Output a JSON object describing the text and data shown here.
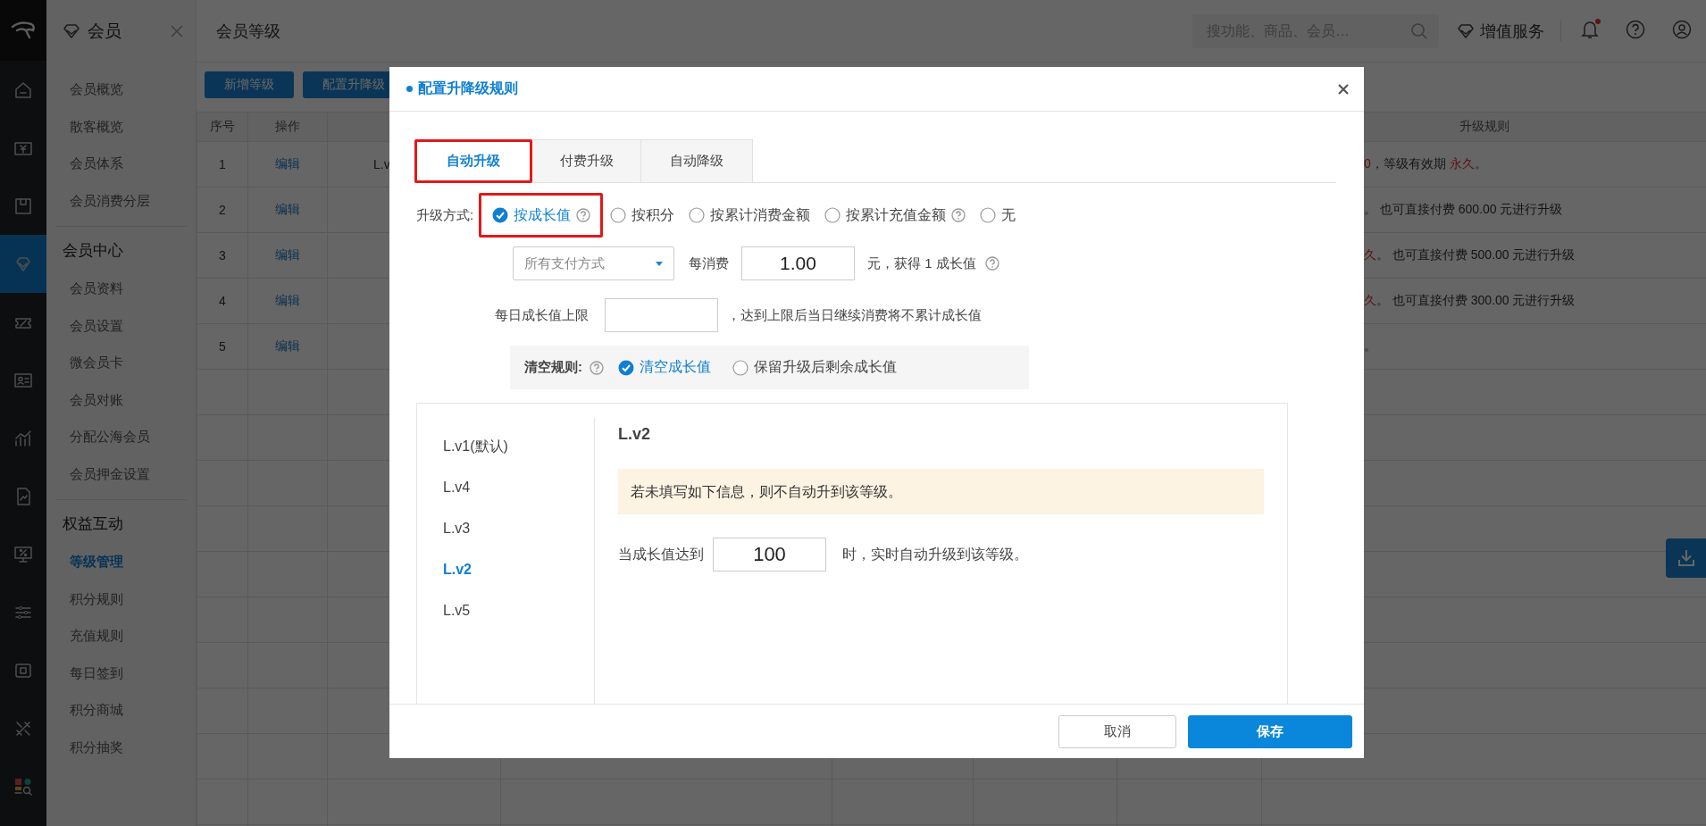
{
  "rail": {
    "items": [
      {
        "selected": false
      },
      {
        "selected": false
      },
      {
        "selected": false
      },
      {
        "selected": true
      },
      {
        "selected": false
      },
      {
        "selected": false
      },
      {
        "selected": false
      },
      {
        "selected": false
      },
      {
        "selected": false
      },
      {
        "selected": false
      },
      {
        "selected": false
      },
      {
        "selected": false
      },
      {
        "selected": false
      }
    ]
  },
  "sidebar": {
    "title": "会员",
    "sections": [
      {
        "items": [
          {
            "label": "会员概览",
            "selected": false
          },
          {
            "label": "散客概览",
            "selected": false
          },
          {
            "label": "会员体系",
            "selected": false
          },
          {
            "label": "会员消费分层",
            "selected": false
          }
        ]
      },
      {
        "heading": "会员中心",
        "items": [
          {
            "label": "会员资料",
            "selected": false
          },
          {
            "label": "会员设置",
            "selected": false
          },
          {
            "label": "微会员卡",
            "selected": false
          },
          {
            "label": "会员对账",
            "selected": false
          },
          {
            "label": "分配公海会员",
            "selected": false
          },
          {
            "label": "会员押金设置",
            "selected": false
          }
        ]
      },
      {
        "heading": "权益互动",
        "items": [
          {
            "label": "等级管理",
            "selected": true
          },
          {
            "label": "积分规则",
            "selected": false
          },
          {
            "label": "充值规则",
            "selected": false
          },
          {
            "label": "每日签到",
            "selected": false
          },
          {
            "label": "积分商城",
            "selected": false
          },
          {
            "label": "积分抽奖",
            "selected": false
          }
        ]
      }
    ]
  },
  "header": {
    "title": "会员等级",
    "search": {
      "placeholder": "搜功能、商品、会员…"
    },
    "service": "增值服务",
    "notification_dot": true
  },
  "toolbar": {
    "buttons": [
      "新增等级",
      "配置升降级"
    ]
  },
  "table": {
    "columns": [
      {
        "label": "序号"
      },
      {
        "label": "操作"
      },
      {},
      {},
      {},
      {},
      {},
      {
        "label": "升级规则"
      }
    ],
    "rows": [
      {
        "number": "1",
        "action": "编辑",
        "column_3": "L.v",
        "rule": [
          {
            "text": "0",
            "emphasis": true
          },
          {
            "text": "，等级有效期 "
          },
          {
            "text": "永久",
            "emphasis": true
          },
          {
            "text": "。"
          }
        ]
      },
      {
        "number": "2",
        "action": "编辑",
        "rule": [
          {
            "text": "。 也可直接付费 600.00 元进行升级"
          }
        ]
      },
      {
        "number": "3",
        "action": "编辑",
        "rule": [
          {
            "text": "久",
            "emphasis": true
          },
          {
            "text": "。 也可直接付费 500.00 元进行升级"
          }
        ]
      },
      {
        "number": "4",
        "action": "编辑",
        "rule": [
          {
            "text": "久",
            "emphasis": true
          },
          {
            "text": "。 也可直接付费 300.00 元进行升级"
          }
        ]
      },
      {
        "number": "5",
        "action": "编辑",
        "rule": [
          {
            "text": "。"
          }
        ]
      }
    ]
  },
  "dialog": {
    "title": "配置升降级规则",
    "tabs": [
      {
        "label": "自动升级",
        "selected": true,
        "highlighted": true
      },
      {
        "label": "付费升级",
        "selected": false,
        "highlighted": false
      },
      {
        "label": "自动降级",
        "selected": false,
        "highlighted": false
      }
    ],
    "method": {
      "label": "升级方式:",
      "options": [
        {
          "label": "按成长值",
          "selected": true,
          "help": true,
          "highlighted": true
        },
        {
          "label": "按积分",
          "selected": false,
          "help": false,
          "highlighted": false
        },
        {
          "label": "按累计消费金额",
          "selected": false,
          "help": false,
          "highlighted": false
        },
        {
          "label": "按累计充值金额",
          "selected": false,
          "help": true,
          "highlighted": false
        },
        {
          "label": "无",
          "selected": false,
          "help": false,
          "highlighted": false
        }
      ]
    },
    "rate": {
      "select": "所有支付方式",
      "prefix": "每消费",
      "value": "1.00",
      "suffix": "元，获得 1 成长值",
      "help": true
    },
    "daily": {
      "label": "每日成长值上限",
      "suffix": "，达到上限后当日继续消费将不累计成长值"
    },
    "clear": {
      "label": "清空规则:",
      "help": true,
      "options": [
        {
          "label": "清空成长值",
          "selected": true
        },
        {
          "label": "保留升级后剩余成长值",
          "selected": false
        }
      ]
    },
    "levels": [
      {
        "label": "L.v1(默认)",
        "selected": false
      },
      {
        "label": "L.v4",
        "selected": false
      },
      {
        "label": "L.v3",
        "selected": false
      },
      {
        "label": "L.v2",
        "selected": true
      },
      {
        "label": "L.v5",
        "selected": false
      }
    ],
    "detail": {
      "title": "L.v2",
      "notice": "若未填写如下信息，则不自动升到该等级。",
      "prefix": "当成长值达到",
      "value": "100",
      "suffix": "时，实时自动升级到该等级。"
    },
    "buttons": [
      {
        "label": "取消",
        "kind": "secondary"
      },
      {
        "label": "保存",
        "kind": "primary"
      }
    ]
  }
}
